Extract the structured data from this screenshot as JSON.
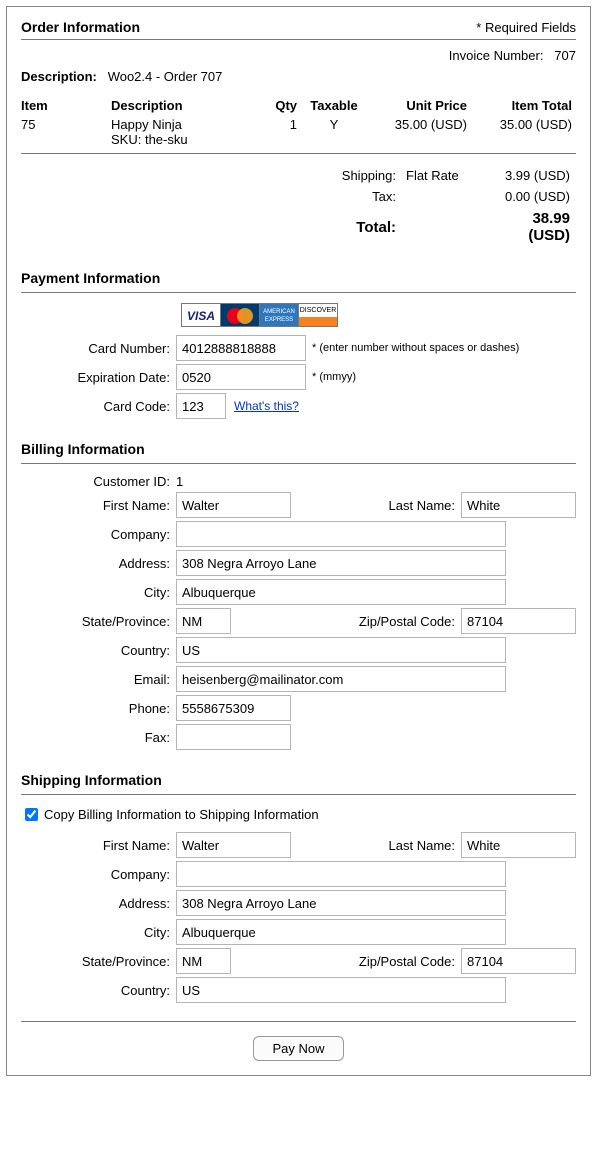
{
  "order_info": {
    "title": "Order Information",
    "required_fields": "* Required Fields",
    "invoice_label": "Invoice Number:",
    "invoice_number": "707",
    "description_label": "Description:",
    "description_value": "Woo2.4 - Order 707"
  },
  "items_header": {
    "item": "Item",
    "description": "Description",
    "qty": "Qty",
    "taxable": "Taxable",
    "unit_price": "Unit Price",
    "item_total": "Item Total"
  },
  "items": [
    {
      "item": "75",
      "description": "Happy Ninja",
      "sku": "SKU: the-sku",
      "qty": "1",
      "taxable": "Y",
      "unit_price": "35.00 (USD)",
      "item_total": "35.00 (USD)"
    }
  ],
  "totals": {
    "shipping_label": "Shipping:",
    "shipping_method": "Flat Rate",
    "shipping_value": "3.99 (USD)",
    "tax_label": "Tax:",
    "tax_value": "0.00 (USD)",
    "total_label": "Total:",
    "total_value": "38.99 (USD)"
  },
  "payment": {
    "title": "Payment Information",
    "card_number_label": "Card Number:",
    "card_number_value": "4012888818888",
    "card_number_hint": "* (enter number without spaces or dashes)",
    "exp_label": "Expiration Date:",
    "exp_value": "0520",
    "exp_hint": "* (mmyy)",
    "code_label": "Card Code:",
    "code_value": "123",
    "whats_this": "What's this?",
    "card_brands": [
      "VISA",
      "MasterCard",
      "American Express",
      "Discover"
    ]
  },
  "billing": {
    "title": "Billing Information",
    "customer_id_label": "Customer ID:",
    "customer_id_value": "1",
    "first_name_label": "First Name:",
    "first_name_value": "Walter",
    "last_name_label": "Last Name:",
    "last_name_value": "White",
    "company_label": "Company:",
    "company_value": "",
    "address_label": "Address:",
    "address_value": "308 Negra Arroyo Lane",
    "city_label": "City:",
    "city_value": "Albuquerque",
    "state_label": "State/Province:",
    "state_value": "NM",
    "zip_label": "Zip/Postal Code:",
    "zip_value": "87104",
    "country_label": "Country:",
    "country_value": "US",
    "email_label": "Email:",
    "email_value": "heisenberg@mailinator.com",
    "phone_label": "Phone:",
    "phone_value": "5558675309",
    "fax_label": "Fax:",
    "fax_value": ""
  },
  "shipping": {
    "title": "Shipping Information",
    "copy_label": "Copy Billing Information to Shipping Information",
    "copy_checked": true,
    "first_name_label": "First Name:",
    "first_name_value": "Walter",
    "last_name_label": "Last Name:",
    "last_name_value": "White",
    "company_label": "Company:",
    "company_value": "",
    "address_label": "Address:",
    "address_value": "308 Negra Arroyo Lane",
    "city_label": "City:",
    "city_value": "Albuquerque",
    "state_label": "State/Province:",
    "state_value": "NM",
    "zip_label": "Zip/Postal Code:",
    "zip_value": "87104",
    "country_label": "Country:",
    "country_value": "US"
  },
  "pay_button": "Pay Now"
}
